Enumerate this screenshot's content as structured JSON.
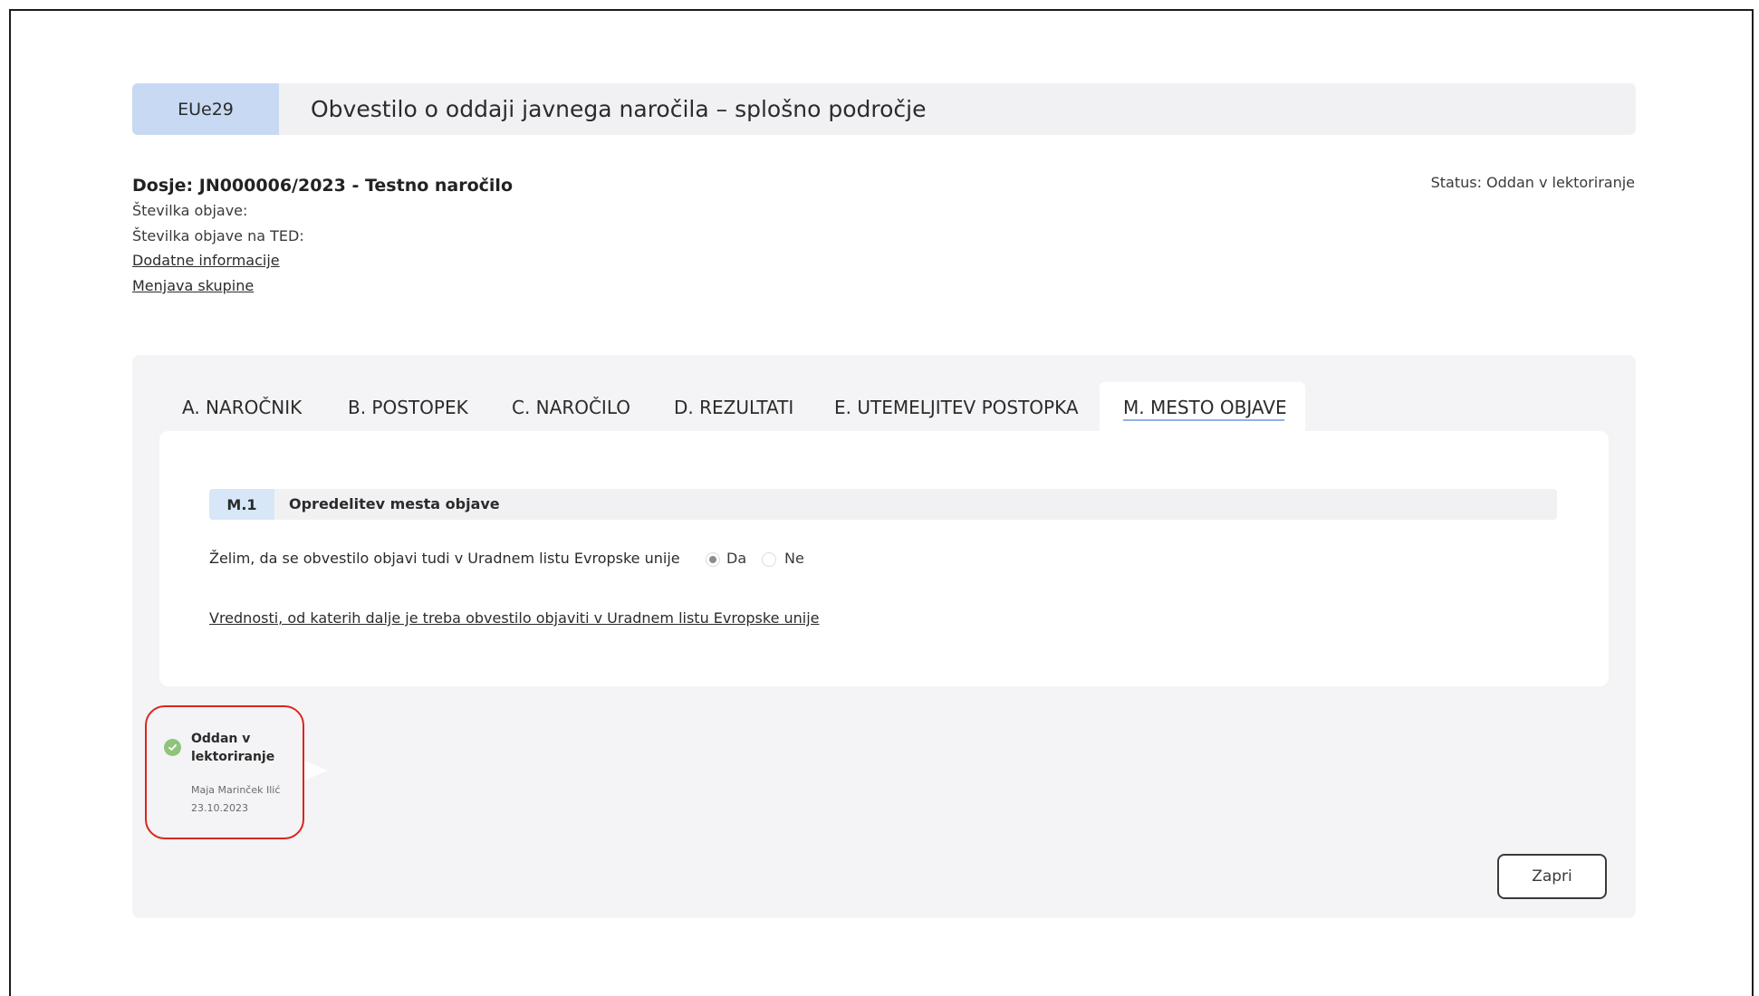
{
  "header": {
    "code": "EUe29",
    "title": "Obvestilo o oddaji javnega naročila – splošno področje"
  },
  "dossier": {
    "title": "Dosje: JN000006/2023 - Testno naročilo",
    "publication_number_label": "Številka objave:",
    "ted_number_label": "Številka objave na TED:",
    "additional_info_link": "Dodatne informacije",
    "change_group_link": "Menjava skupine",
    "status": "Status: Oddan v lektoriranje"
  },
  "tabs": [
    {
      "label": "A. NAROČNIK"
    },
    {
      "label": "B. POSTOPEK"
    },
    {
      "label": "C. NAROČILO"
    },
    {
      "label": "D. REZULTATI"
    },
    {
      "label": "E. UTEMELJITEV POSTOPKA"
    },
    {
      "label": "M. MESTO OBJAVE",
      "active": true
    }
  ],
  "section": {
    "code": "M.1",
    "title": "Opredelitev mesta objave",
    "question": "Želim, da se obvestilo objavi tudi v Uradnem listu Evropske unije",
    "options": [
      {
        "label": "Da",
        "checked": true
      },
      {
        "label": "Ne",
        "checked": false
      }
    ],
    "thresholds_link": "Vrednosti, od katerih dalje je treba obvestilo objaviti v Uradnem listu Evropske unije"
  },
  "timeline": {
    "title": "Oddan v lektoriranje",
    "user": "Maja Marinček Ilić",
    "date": "23.10.2023"
  },
  "actions": {
    "close_label": "Zapri"
  },
  "colors": {
    "header_code_bg": "#c8d9f3",
    "section_code_bg": "#d7e7f8",
    "panel_bg": "#f4f4f6",
    "highlight_border": "#d9261c",
    "check_green": "#8fc47c"
  }
}
